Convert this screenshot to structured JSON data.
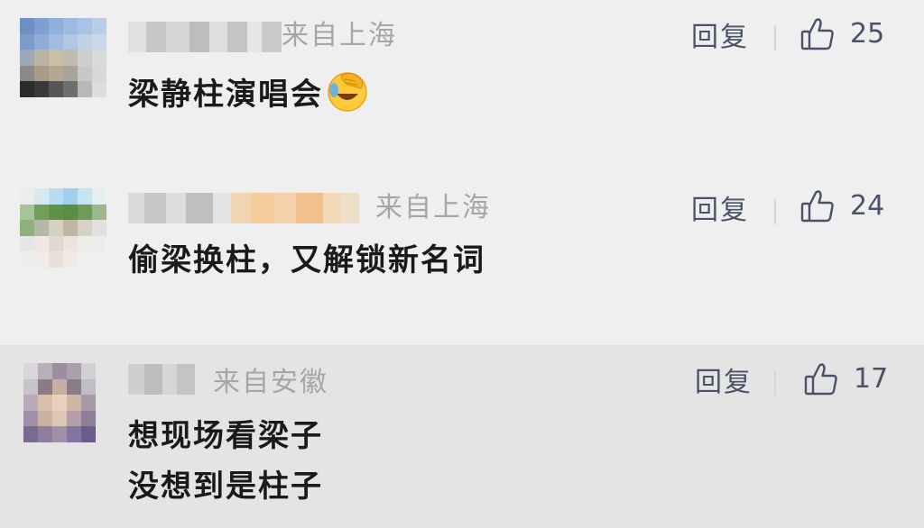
{
  "comments": [
    {
      "location": "来自上海",
      "text": "梁静柱演唱会",
      "emoji": "facepalm-laugh-emoji",
      "reply_label": "回复",
      "likes": "25",
      "icons": {
        "like": "thumbs-up-icon"
      }
    },
    {
      "location": "来自上海",
      "text": "偷梁换柱，又解锁新名词",
      "reply_label": "回复",
      "likes": "24",
      "icons": {
        "like": "thumbs-up-icon"
      }
    },
    {
      "location": "来自安徽",
      "text_lines": [
        "想现场看梁子",
        "没想到是柱子"
      ],
      "reply_label": "回复",
      "likes": "17",
      "icons": {
        "like": "thumbs-up-icon"
      }
    }
  ],
  "colors": {
    "background": "#efefef",
    "highlight_row": "#e4e4e4",
    "meta_text": "#a6a6a6",
    "action_text": "#4a5268",
    "content_text": "#1a1a1a"
  }
}
